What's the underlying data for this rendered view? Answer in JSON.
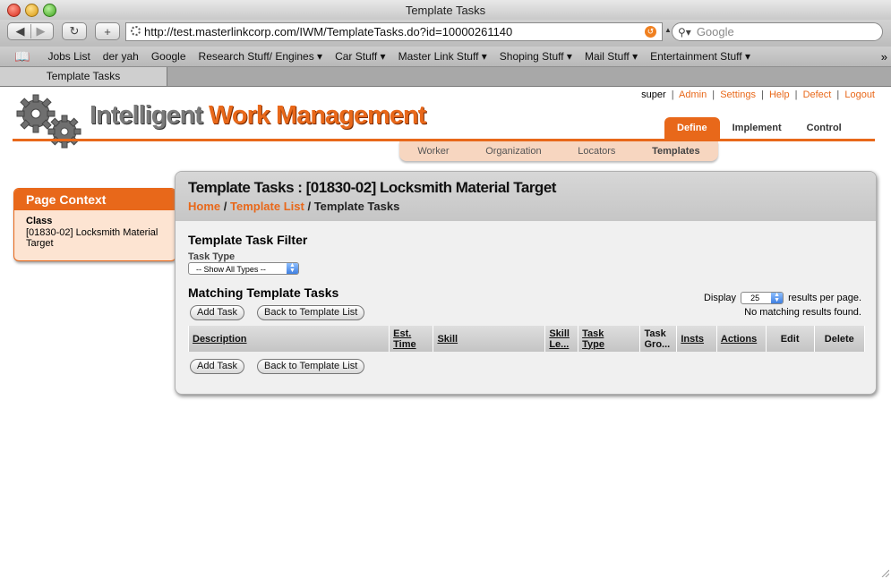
{
  "browser": {
    "window_title": "Template Tasks",
    "url": "http://test.masterlinkcorp.com/IWM/TemplateTasks.do?id=10000261140",
    "search_placeholder": "Google",
    "bookmarks": [
      "Jobs List",
      "der yah",
      "Google",
      "Research Stuff/ Engines ▾",
      "Car Stuff ▾",
      "Master Link Stuff ▾",
      "Shoping Stuff ▾",
      "Mail Stuff ▾",
      "Entertainment Stuff ▾"
    ],
    "tab_label": "Template Tasks"
  },
  "utility": {
    "user": "super",
    "links": [
      "Admin",
      "Settings",
      "Help",
      "Defect",
      "Logout"
    ]
  },
  "logo": {
    "part1": "Intelligent",
    "part2": "Work Management"
  },
  "main_nav": [
    "Define",
    "Implement",
    "Control"
  ],
  "sub_nav": [
    "Worker",
    "Organization",
    "Locators",
    "Templates"
  ],
  "context": {
    "header": "Page Context",
    "label": "Class",
    "value": "[01830-02] Locksmith Material Target"
  },
  "main": {
    "title": "Template Tasks : [01830-02] Locksmith Material Target",
    "breadcrumb": {
      "home": "Home",
      "list": "Template List",
      "current": "Template Tasks"
    },
    "filter_title": "Template Task Filter",
    "task_type_label": "Task Type",
    "task_type_selected": "-- Show All Types --",
    "matching_title": "Matching Template Tasks",
    "display_label": "Display",
    "display_value": "25",
    "display_suffix": "results per page.",
    "no_results": "No matching results found.",
    "add_task": "Add Task",
    "back_to_list": "Back to Template List",
    "columns": [
      {
        "l1": "Description",
        "l2": ""
      },
      {
        "l1": "Est.",
        "l2": "Time"
      },
      {
        "l1": "Skill",
        "l2": ""
      },
      {
        "l1": "Skill",
        "l2": "Le..."
      },
      {
        "l1": "Task",
        "l2": "Type"
      },
      {
        "l1": "Task",
        "l2": "Gro..."
      },
      {
        "l1": "Insts",
        "l2": ""
      },
      {
        "l1": "Actions",
        "l2": ""
      },
      {
        "l1": "Edit",
        "l2": ""
      },
      {
        "l1": "Delete",
        "l2": ""
      }
    ]
  },
  "colors": {
    "accent": "#e8681a",
    "panel": "#f0f0f0",
    "context_bg": "#fde4d2"
  }
}
